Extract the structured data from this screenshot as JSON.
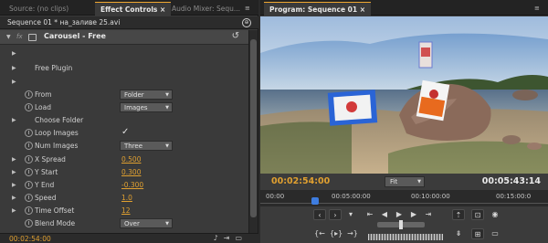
{
  "left_panel": {
    "tabs": [
      {
        "label": "Source: (no clips)"
      },
      {
        "label": "Effect Controls ×"
      },
      {
        "label": "Audio Mixer: Sequ..."
      }
    ],
    "tab_menu": "≡",
    "sequence_label": "Sequence 01 * на_заливе 25.avi",
    "effect": {
      "fx": "fx",
      "title": "Carousel - Free"
    },
    "rows": [
      {
        "name": "expander-1",
        "label": ""
      },
      {
        "name": "free-plugin",
        "label": "Free Plugin"
      },
      {
        "name": "expander-2",
        "label": ""
      },
      {
        "name": "from",
        "label": "From",
        "dropdown": "Folder"
      },
      {
        "name": "load",
        "label": "Load",
        "dropdown": "Images"
      },
      {
        "name": "choose-folder",
        "label": "Choose Folder"
      },
      {
        "name": "loop-images",
        "label": "Loop Images",
        "checked": "✓"
      },
      {
        "name": "num-images",
        "label": "Num Images",
        "dropdown": "Three"
      },
      {
        "name": "x-spread",
        "label": "X Spread",
        "value": "0.500"
      },
      {
        "name": "y-start",
        "label": "Y Start",
        "value": "0.300"
      },
      {
        "name": "y-end",
        "label": "Y End",
        "value": "-0.300"
      },
      {
        "name": "speed",
        "label": "Speed",
        "value": "1.0"
      },
      {
        "name": "time-offset",
        "label": "Time Offset",
        "value": "12"
      },
      {
        "name": "blend-mode",
        "label": "Blend Mode",
        "dropdown": "Over"
      }
    ],
    "bottom_timecode": "00:02:54:00"
  },
  "right_panel": {
    "tab": "Program: Sequence 01 ×",
    "tab_menu": "≡",
    "current_timecode": "00:02:54:00",
    "zoom": "Fit",
    "duration": "00:05:43:14",
    "ruler_ticks": [
      "00:00",
      "00:05:00:00",
      "00:10:00:00",
      "00:15:00:0"
    ]
  },
  "colors": {
    "timecode": "#e0a030",
    "playhead": "#3e7de0",
    "tab_accent": "#f0a830"
  }
}
